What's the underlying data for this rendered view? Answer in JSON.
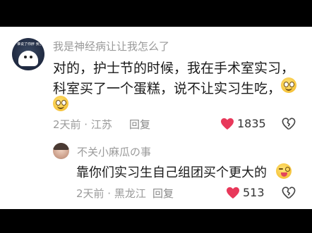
{
  "comment": {
    "username": "我是神经病让让我怎么了",
    "avatar_text": "谁说了你胖 我当面把你骂",
    "text_line1": "对的，护士节的时候，我在手术室实习，",
    "text_line2": "科室买了一个蛋糕，说不让实习生吃，",
    "time_location": "2天前 · 江苏",
    "reply_label": "回复",
    "like_count": "1835",
    "emoji": "smiling-face-emoji"
  },
  "reply": {
    "username": "不关小麻瓜の事",
    "text": "靠你们实习生自己组团买个更大的",
    "time_location": "2天前 · 黑龙江",
    "reply_label": "回复",
    "like_count": "513",
    "emoji": "winking-tongue-emoji"
  },
  "colors": {
    "like_heart": "#e8385a",
    "secondary_text": "#9a9a9a",
    "primary_text": "#1a1a1a"
  },
  "icons": [
    "heart-icon",
    "broken-heart-icon"
  ]
}
